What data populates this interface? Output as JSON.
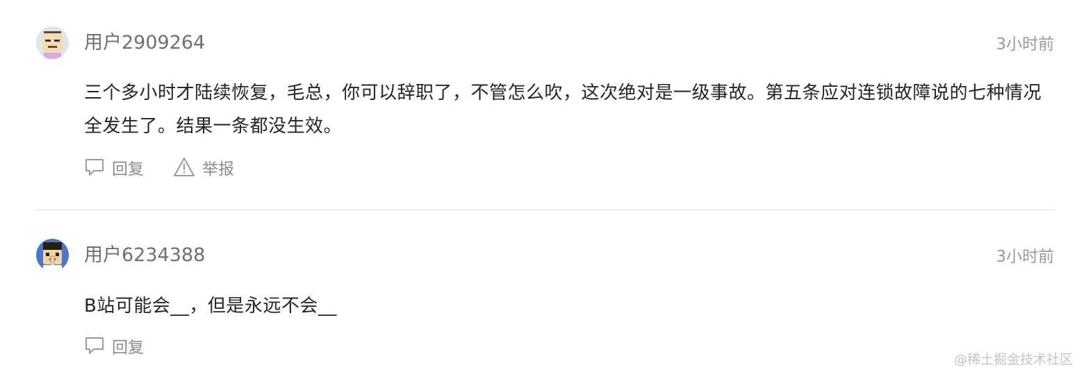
{
  "comments": [
    {
      "username": "用户2909264",
      "time": "3小时前",
      "content": "三个多小时才陆续恢复，毛总，你可以辞职了，不管怎么吹，这次绝对是一级事故。第五条应对连锁故障说的七种情况全发生了。结果一条都没生效。",
      "reply_label": "回复",
      "report_label": "举报"
    },
    {
      "username": "用户6234388",
      "time": "3小时前",
      "content": "B站可能会__，但是永远不会__",
      "reply_label": "回复"
    }
  ],
  "watermark": "@稀土掘金技术社区"
}
